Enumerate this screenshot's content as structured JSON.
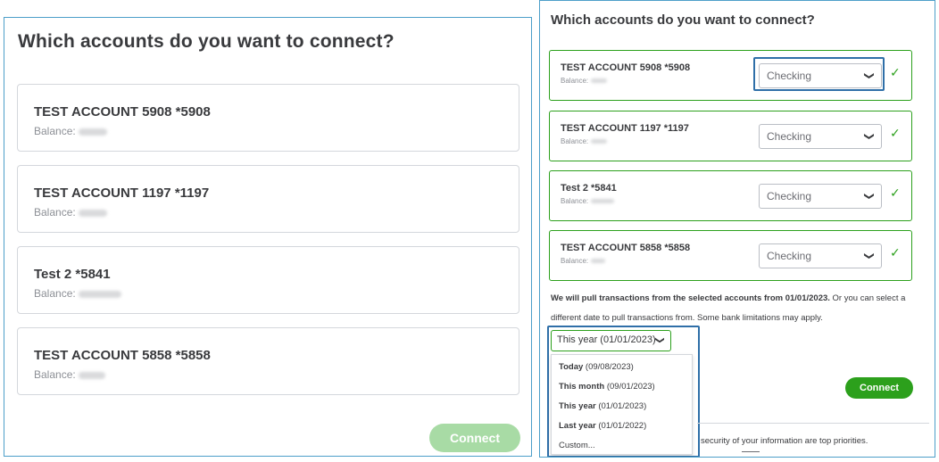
{
  "left": {
    "title": "Which accounts do you want to connect?",
    "balance_label": "Balance:",
    "accounts": [
      {
        "name": "TEST ACCOUNT 5908 *5908"
      },
      {
        "name": "TEST ACCOUNT 1197 *1197"
      },
      {
        "name": "Test 2 *5841"
      },
      {
        "name": "TEST ACCOUNT 5858 *5858"
      }
    ],
    "connect_label": "Connect"
  },
  "right": {
    "title": "Which accounts do you want to connect?",
    "balance_label": "Balance:",
    "accounts": [
      {
        "name": "TEST ACCOUNT 5908 *5908",
        "type": "Checking"
      },
      {
        "name": "TEST ACCOUNT 1197 *1197",
        "type": "Checking"
      },
      {
        "name": "Test 2 *5841",
        "type": "Checking"
      },
      {
        "name": "TEST ACCOUNT 5858 *5858",
        "type": "Checking"
      }
    ],
    "info_bold": "We will pull transactions from the selected accounts from 01/01/2023.",
    "info_rest": " Or you can select a different date to pull transactions from. Some bank limitations may apply.",
    "date_selected": "This year (01/01/2023)",
    "date_options": [
      {
        "label": "Today",
        "date": "(09/08/2023)"
      },
      {
        "label": "This month",
        "date": "(09/01/2023)"
      },
      {
        "label": "This year",
        "date": "(01/01/2023)"
      },
      {
        "label": "Last year",
        "date": "(01/01/2022)"
      },
      {
        "label": "Custom...",
        "date": ""
      }
    ],
    "connect_label": "Connect",
    "security_text": "security of your information are top priorities."
  },
  "icons": {
    "chevron": "chevron-down-icon",
    "check": "check-icon"
  },
  "colors": {
    "accent_green": "#2ca01c",
    "disabled_green": "#a8dba5",
    "highlight_blue": "#2f6fa8",
    "panel_border": "#4d9fc9"
  }
}
